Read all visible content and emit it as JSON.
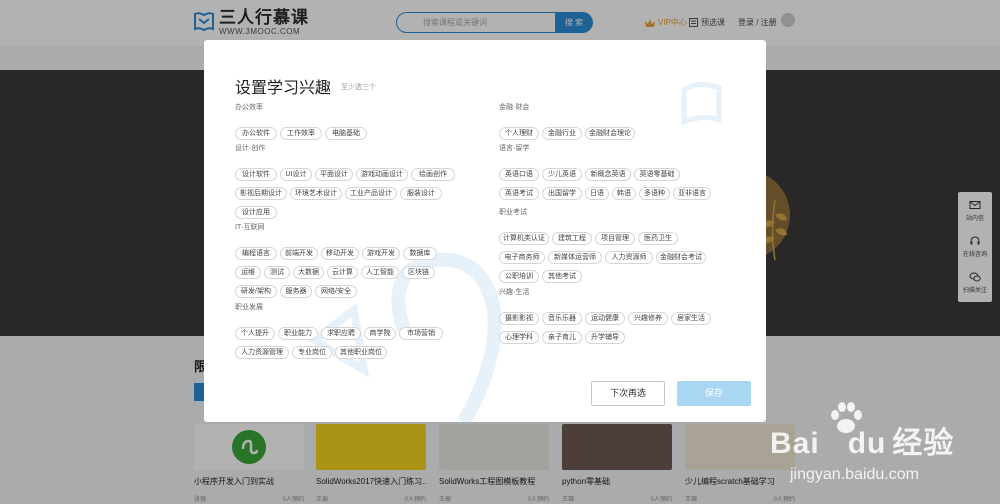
{
  "header": {
    "logo_text": "三人行慕课",
    "logo_sub": "WWW.3MOOC.COM",
    "search_placeholder": "搜索课程或关键词",
    "search_button": "搜 索",
    "vip_label": "VIP中心",
    "cart_label": "预选课",
    "login_label": "登录 / 注册"
  },
  "side_bar": {
    "items": [
      {
        "label": "站内信",
        "icon": "mail-icon"
      },
      {
        "label": "在线咨询",
        "icon": "headset-icon"
      },
      {
        "label": "扫描关注",
        "icon": "wechat-icon"
      }
    ]
  },
  "section": {
    "title": "限"
  },
  "courses": [
    {
      "name": "小程序开发入门到实战",
      "teacher": "张强",
      "students": "0人预约",
      "thumb_color": "#ffffff"
    },
    {
      "name": "SolidWorks2017快速入门练习...",
      "teacher": "王振",
      "students": "0人预约",
      "thumb_color": "#f2d51f"
    },
    {
      "name": "SolidWorks工程图模板教程",
      "teacher": "王振",
      "students": "0人预约",
      "thumb_color": "#e9e9e3"
    },
    {
      "name": "python零基础",
      "teacher": "王锦",
      "students": "0人预约",
      "thumb_color": "#6d5b52"
    },
    {
      "name": "少儿编程scratch基础学习",
      "teacher": "王锦",
      "students": "0人预约",
      "thumb_color": "#f3ead6"
    }
  ],
  "modal": {
    "title": "设置学习兴趣",
    "subtitle": "至少选三个",
    "categories_left": [
      {
        "label": "办公效率",
        "tags": [
          "办公软件",
          "工作效率",
          "电脑基础"
        ]
      },
      {
        "label": "设计·创作",
        "tags": [
          "设计软件",
          "UI设计",
          "平面设计",
          "游戏动画设计",
          "绘画创作",
          "影视后期设计",
          "环境艺术设计",
          "工业产品设计",
          "服装设计",
          "设计应用"
        ]
      },
      {
        "label": "IT·互联网",
        "tags": [
          "编程语言",
          "前端开发",
          "移动开发",
          "游戏开发",
          "数据库",
          "运维",
          "测试",
          "大数据",
          "云计算",
          "人工智能",
          "区块链",
          "研发/架构",
          "服务器",
          "网络/安全"
        ]
      },
      {
        "label": "职业发展",
        "tags": [
          "个人提升",
          "职业能力",
          "求职应聘",
          "商学院",
          "市场营销",
          "人力资源管理",
          "专业岗位",
          "其他职业岗位"
        ]
      }
    ],
    "categories_right": [
      {
        "label": "金融·财会",
        "tags": [
          "个人理财",
          "金融行业",
          "金融财会理论"
        ]
      },
      {
        "label": "语言·留学",
        "tags": [
          "英语口语",
          "少儿英语",
          "新概念英语",
          "英语零基础",
          "英语考试",
          "出国留学",
          "日语",
          "韩语",
          "多语种",
          "亚非语言"
        ]
      },
      {
        "label": "职业考试",
        "tags": [
          "计算机类认证",
          "建筑工程",
          "项目管理",
          "医药卫生",
          "电子商务师",
          "新媒体运营师",
          "人力资源师",
          "金融财会考试",
          "公职培训",
          "其他考试"
        ]
      },
      {
        "label": "兴趣·生活",
        "tags": [
          "摄影影视",
          "音乐乐器",
          "运动健康",
          "兴趣修养",
          "居家生活",
          "心理学科",
          "亲子育儿",
          "升学辅导"
        ]
      }
    ],
    "later_button": "下次再选",
    "save_button": "保存"
  },
  "watermark": {
    "text": "Bai",
    "text2": "经验",
    "url": "jingyan.baidu.com"
  },
  "colors": {
    "accent": "#2a8bd6",
    "save_disabled": "#a9d6f2",
    "banner_bg": "#3c3a39",
    "vip": "#e8a33b"
  }
}
